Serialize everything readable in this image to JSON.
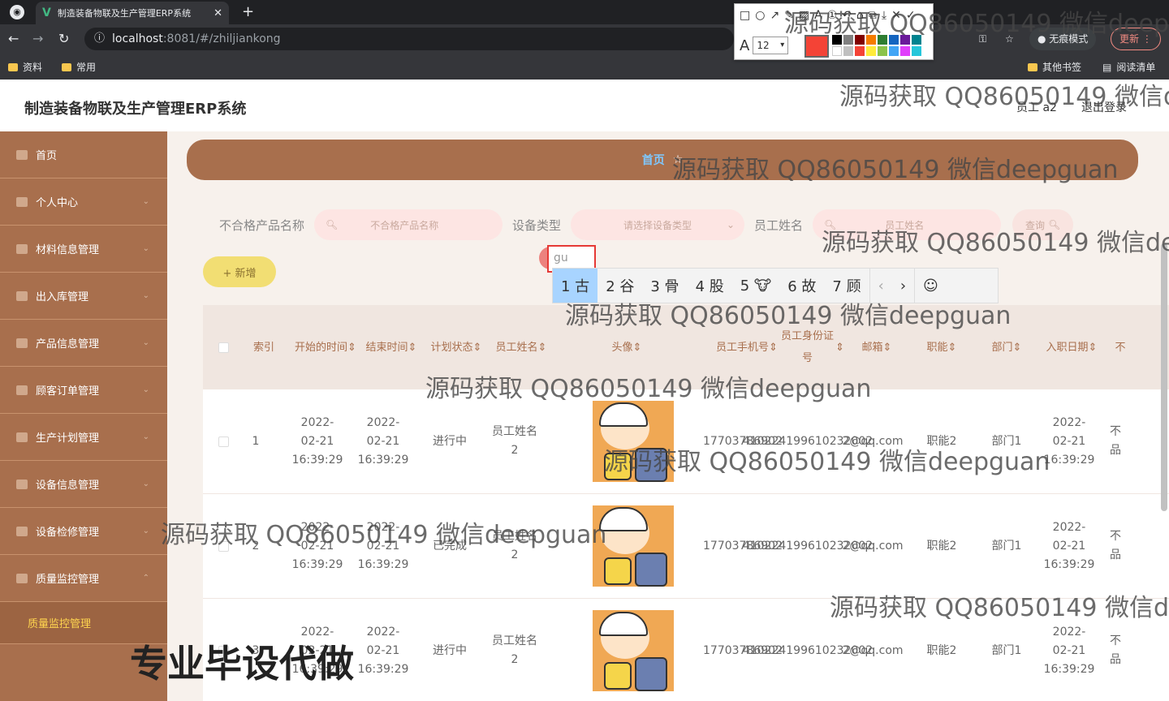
{
  "browser": {
    "tab_title": "制造装备物联及生产管理ERP系统",
    "url_host": "localhost",
    "url_rest": ":8081/#/zhiljiankong",
    "incognito": "无痕模式",
    "update": "更新",
    "bookmarks": [
      "资料",
      "常用"
    ],
    "bookmarks_right": [
      "其他书签",
      "阅读清单"
    ]
  },
  "annot_tool": {
    "font_size": "12"
  },
  "header": {
    "title": "制造装备物联及生产管理ERP系统",
    "user": "员工 a2",
    "logout": "退出登录"
  },
  "sidebar": {
    "items": [
      "首页",
      "个人中心",
      "材料信息管理",
      "出入库管理",
      "产品信息管理",
      "顾客订单管理",
      "生产计划管理",
      "设备信息管理",
      "设备检修管理",
      "质量监控管理"
    ],
    "sub_item": "质量监控管理"
  },
  "breadcrumb": {
    "home": "首页"
  },
  "search": {
    "label1": "不合格产品名称",
    "placeholder1": "不合格产品名称",
    "label2": "设备类型",
    "placeholder2": "请选择设备类型",
    "label3": "员工姓名",
    "placeholder3": "员工姓名",
    "query": "查询"
  },
  "add_button": "+ 新增",
  "ime": {
    "composing": "gu",
    "candidates": [
      "1 古",
      "2 谷",
      "3 骨",
      "4 股",
      "5 🐮",
      "6 故",
      "7 顾"
    ]
  },
  "table": {
    "headers": [
      "索引",
      "开始的时间",
      "结束时间",
      "计划状态",
      "员工姓名",
      "头像",
      "员工手机号",
      "员工身份证号",
      "邮箱",
      "职能",
      "部门",
      "入职日期",
      "不"
    ],
    "rows": [
      {
        "idx": "1",
        "start": "2022-02-21 16:39:29",
        "end": "2022-02-21 16:39:29",
        "status": "进行中",
        "name": "员工姓名2",
        "phone": "17703786902",
        "idcard": "410224199610232002",
        "email": "2@qq.com",
        "role": "职能2",
        "dept": "部门1",
        "join": "2022-02-21 16:39:29",
        "extra": "不品"
      },
      {
        "idx": "2",
        "start": "2022-02-21 16:39:29",
        "end": "2022-02-21 16:39:29",
        "status": "已完成",
        "name": "员工姓名2",
        "phone": "17703786902",
        "idcard": "410224199610232002",
        "email": "2@qq.com",
        "role": "职能2",
        "dept": "部门1",
        "join": "2022-02-21 16:39:29",
        "extra": "不品"
      },
      {
        "idx": "3",
        "start": "2022-02-21 16:39:29",
        "end": "2022-02-21 16:39:29",
        "status": "进行中",
        "name": "员工姓名2",
        "phone": "17703786902",
        "idcard": "410224199610232002",
        "email": "2@qq.com",
        "role": "职能2",
        "dept": "部门1",
        "join": "2022-02-21 16:39:29",
        "extra": "不品"
      }
    ]
  },
  "watermark": "源码获取 QQ86050149 微信deepguan",
  "watermark_big": "专业毕设代做"
}
